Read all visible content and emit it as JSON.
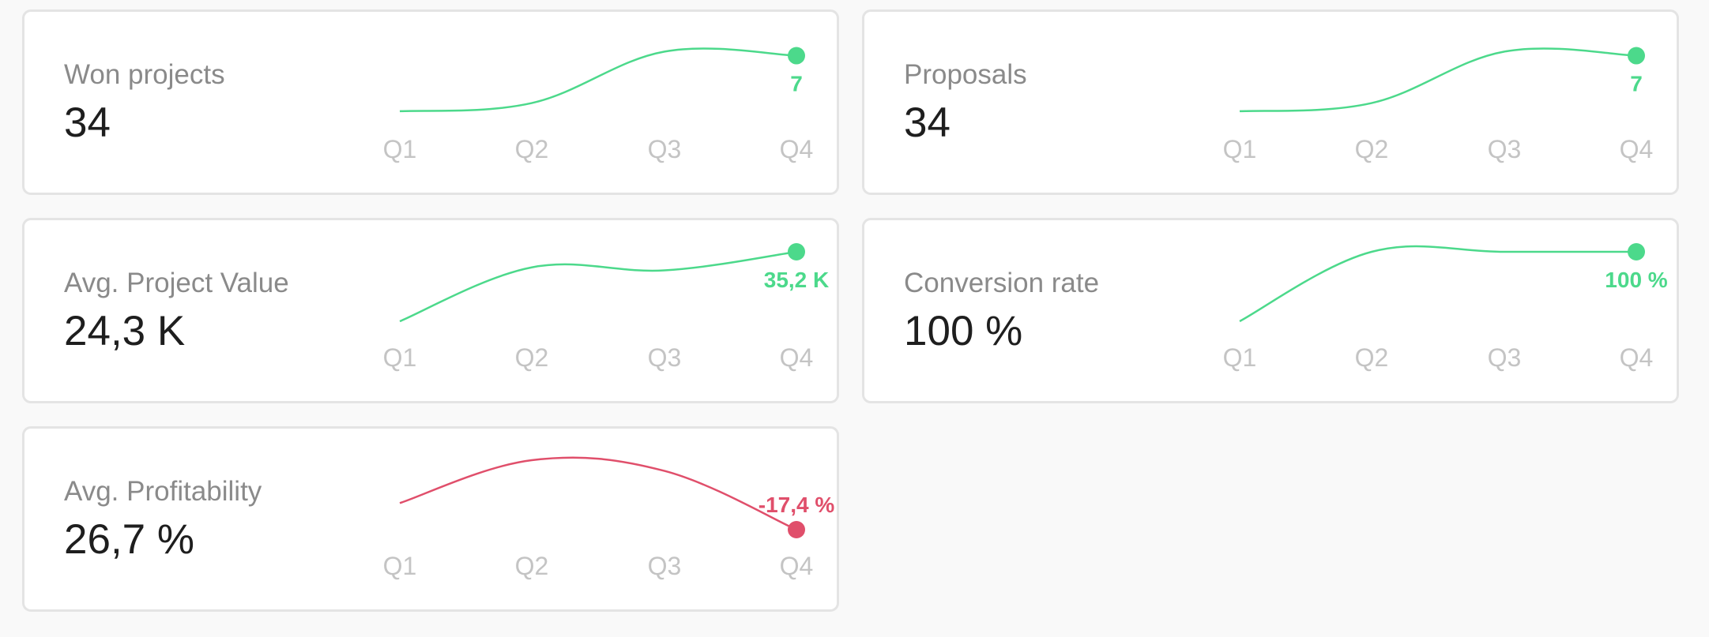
{
  "colors": {
    "positive": "#4cd98b",
    "negative": "#e04f6b"
  },
  "quarters": [
    "Q1",
    "Q2",
    "Q3",
    "Q4"
  ],
  "cards": [
    {
      "key": "won_projects",
      "label": "Won projects",
      "value": "34",
      "end_label": "7",
      "trend": "positive",
      "series": [
        0.2,
        1.2,
        7.5,
        7
      ],
      "ylim": [
        0,
        8.5
      ]
    },
    {
      "key": "proposals",
      "label": "Proposals",
      "value": "34",
      "end_label": "7",
      "trend": "positive",
      "series": [
        0.2,
        1.2,
        7.5,
        7
      ],
      "ylim": [
        0,
        8.5
      ]
    },
    {
      "key": "avg_project_value",
      "label": "Avg. Project Value",
      "value": "24,3 K",
      "end_label": "35,2 K",
      "trend": "positive",
      "series": [
        12,
        30,
        29,
        35.2
      ],
      "ylim": [
        12,
        35.2
      ]
    },
    {
      "key": "conversion_rate",
      "label": "Conversion rate",
      "value": "100 %",
      "end_label": "100 %",
      "trend": "positive",
      "series": [
        25,
        100,
        100,
        100
      ],
      "ylim": [
        25,
        100
      ]
    },
    {
      "key": "avg_profitability",
      "label": "Avg. Profitability",
      "value": "26,7 %",
      "end_label": "-17,4 %",
      "trend": "negative",
      "series": [
        -5,
        15,
        10,
        -17.4
      ],
      "ylim": [
        -17.4,
        15
      ]
    }
  ]
}
